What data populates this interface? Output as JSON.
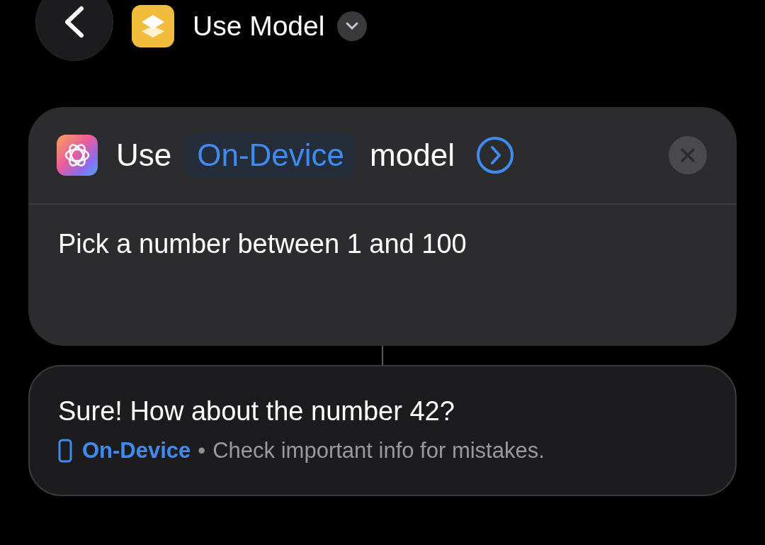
{
  "header": {
    "title": "Use Model"
  },
  "action": {
    "prefix": "Use",
    "model": "On-Device",
    "suffix": "model",
    "prompt": "Pick a number between 1 and 100"
  },
  "result": {
    "text": "Sure! How about the number 42?",
    "source": "On-Device",
    "separator": "•",
    "note": "Check important info for mistakes."
  }
}
